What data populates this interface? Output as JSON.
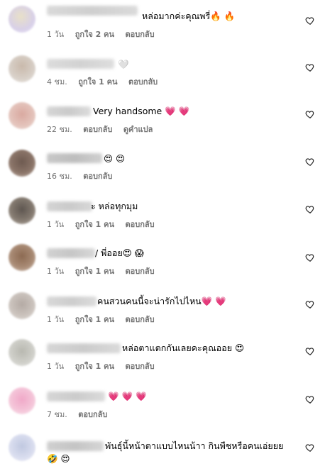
{
  "ui": {
    "reply_label": "ตอบกลับ",
    "translate_label": "ดูคำแปล"
  },
  "colors": {
    "meta": "#737373",
    "heart_emoji": "#e8336d",
    "fire_emoji": "#f26a22"
  },
  "comments": [
    {
      "text": "หล่อมากค่ะคุณพรี่🔥 🔥",
      "time": "1 วัน",
      "likes": "ถูกใจ 2 คน",
      "reply": "ตอบกลับ",
      "icon": "heart-outline-icon"
    },
    {
      "text": "🤍",
      "time": "4 ชม.",
      "likes": "ถูกใจ 1 คน",
      "reply": "ตอบกลับ",
      "icon": "heart-outline-icon"
    },
    {
      "text": "Very handsome 💗 💗",
      "time": "22 ชม.",
      "likes": "",
      "reply": "ตอบกลับ",
      "translate": "ดูคำแปล",
      "icon": "heart-outline-icon"
    },
    {
      "text": "😍 😍",
      "time": "16 ชม.",
      "likes": "",
      "reply": "ตอบกลับ",
      "icon": "heart-outline-icon"
    },
    {
      "text": "ะ หล่อทุกมุม",
      "time": "1 วัน",
      "likes": "ถูกใจ 1 คน",
      "reply": "ตอบกลับ",
      "icon": "heart-outline-icon"
    },
    {
      "text": "/ พี่ออย😍 😱",
      "time": "1 วัน",
      "likes": "ถูกใจ 1 คน",
      "reply": "ตอบกลับ",
      "icon": "heart-outline-icon"
    },
    {
      "text": "คนสวนคนนี้จะน่ารักไปไหน💗 💗",
      "time": "1 วัน",
      "likes": "ถูกใจ 1 คน",
      "reply": "ตอบกลับ",
      "icon": "heart-outline-icon"
    },
    {
      "text": "หล่อตาแตกกันเลยคะคุณออย 😍",
      "time": "1 วัน",
      "likes": "ถูกใจ 1 คน",
      "reply": "ตอบกลับ",
      "icon": "heart-outline-icon"
    },
    {
      "text": "💗 💗 💗",
      "time": "7 ชม.",
      "likes": "",
      "reply": "ตอบกลับ",
      "icon": "heart-outline-icon"
    },
    {
      "text": "พันธุ์นี้หน้าตาแบบไหนน้าา กินพืชหรือคนเอ่ยยย",
      "text2": "🤣 😍",
      "time": "",
      "likes": "",
      "reply": "",
      "icon": "heart-outline-icon"
    }
  ]
}
